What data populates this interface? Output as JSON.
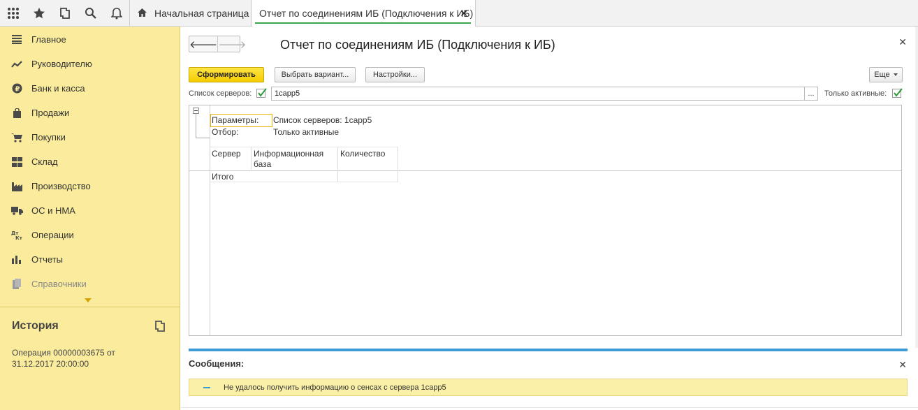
{
  "topbar": {
    "icons": [
      "apps-grid-icon",
      "star-icon",
      "history-icon",
      "search-icon",
      "bell-icon"
    ],
    "home_tab": "Начальная страница",
    "active_tab": "Отчет по соединениям ИБ (Подключения к ИБ)"
  },
  "sidebar": {
    "items": [
      {
        "label": "Главное",
        "icon": "menu-lines-icon"
      },
      {
        "label": "Руководителю",
        "icon": "trend-icon"
      },
      {
        "label": "Банк и касса",
        "icon": "ruble-coin-icon"
      },
      {
        "label": "Продажи",
        "icon": "shopping-bag-icon"
      },
      {
        "label": "Покупки",
        "icon": "cart-icon"
      },
      {
        "label": "Склад",
        "icon": "warehouse-grid-icon"
      },
      {
        "label": "Производство",
        "icon": "factory-icon"
      },
      {
        "label": "ОС и НМА",
        "icon": "truck-icon"
      },
      {
        "label": "Операции",
        "icon": "dt-kt-icon"
      },
      {
        "label": "Отчеты",
        "icon": "bar-chart-icon"
      },
      {
        "label": "Справочники",
        "icon": "books-icon"
      }
    ],
    "history_title": "История",
    "history_entry": "Операция 00000003675 от 31.12.2017 20:00:00"
  },
  "form": {
    "title": "Отчет по соединениям ИБ (Подключения к ИБ)",
    "generate_btn": "Сформировать",
    "variant_btn": "Выбрать вариант...",
    "settings_btn": "Настройки...",
    "more_btn": "Еще",
    "servers_label": "Список серверов:",
    "servers_checked": true,
    "servers_value": "1capp5",
    "servers_dots": "...",
    "active_label": "Только активные:",
    "active_checked": true
  },
  "report": {
    "params_label": "Параметры:",
    "params_value": "Список серверов: 1capp5",
    "filter_label": "Отбор:",
    "filter_value": "Только активные",
    "columns": [
      "Сервер",
      "Информационная база",
      "Количество"
    ],
    "total_label": "Итого"
  },
  "messages": {
    "title": "Сообщения:",
    "items": [
      "Не удалось получить информацию о сенсах с сервера 1capp5"
    ]
  }
}
